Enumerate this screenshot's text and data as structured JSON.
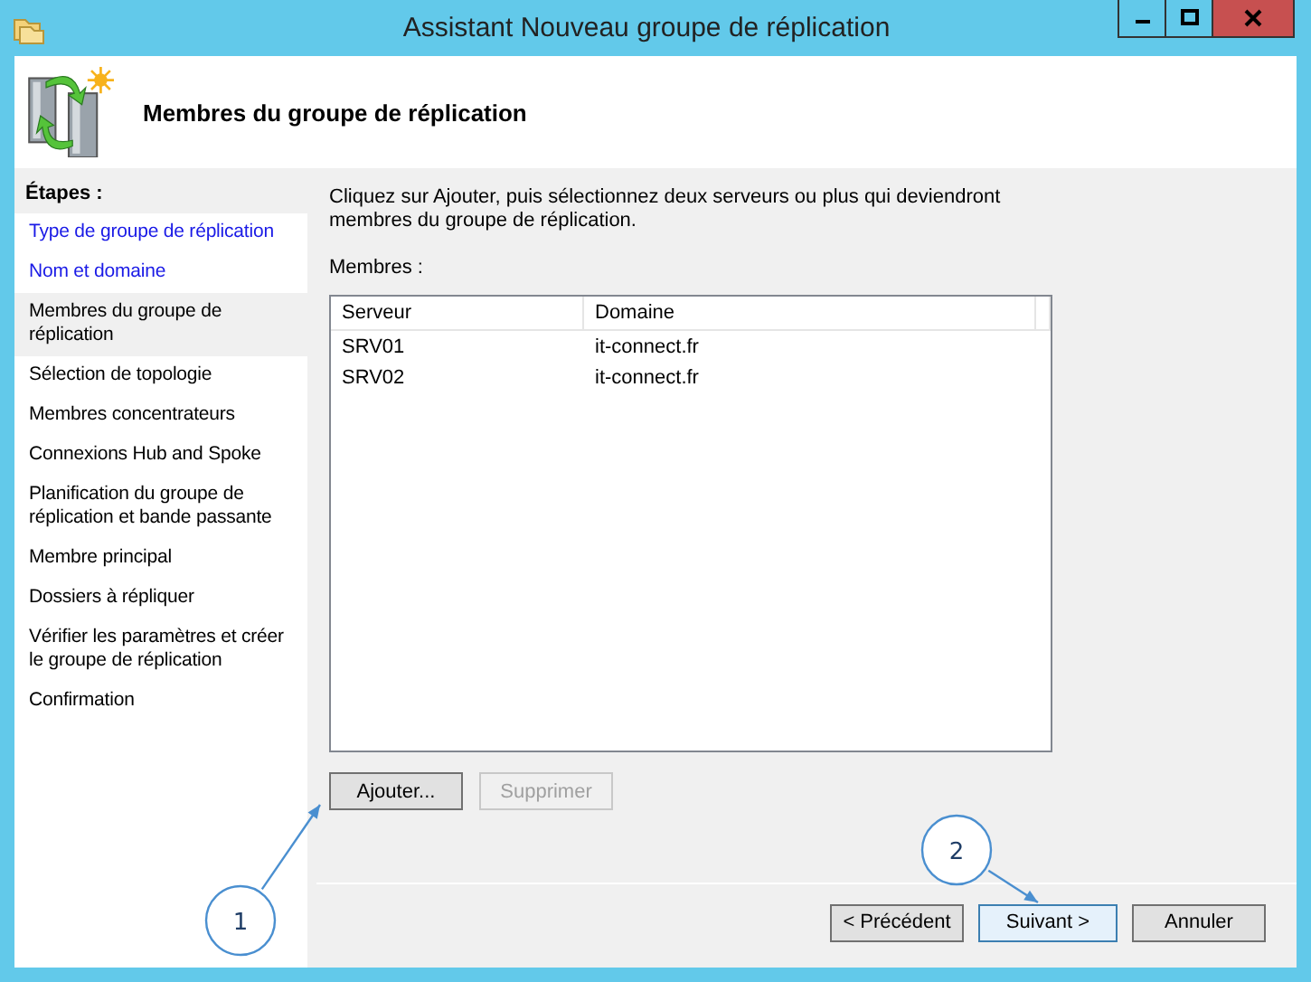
{
  "window": {
    "title": "Assistant Nouveau groupe de réplication"
  },
  "header": {
    "title": "Membres du groupe de réplication"
  },
  "sidebar": {
    "heading": "Étapes :",
    "items": [
      {
        "label": "Type de groupe de réplication",
        "completed": true,
        "selected": false
      },
      {
        "label": "Nom et domaine",
        "completed": true,
        "selected": false
      },
      {
        "label": "Membres du groupe de réplication",
        "completed": false,
        "selected": true
      },
      {
        "label": "Sélection de topologie",
        "completed": false,
        "selected": false
      },
      {
        "label": "Membres concentrateurs",
        "completed": false,
        "selected": false
      },
      {
        "label": "Connexions Hub and Spoke",
        "completed": false,
        "selected": false
      },
      {
        "label": "Planification du groupe de réplication et bande passante",
        "completed": false,
        "selected": false
      },
      {
        "label": "Membre principal",
        "completed": false,
        "selected": false
      },
      {
        "label": "Dossiers à répliquer",
        "completed": false,
        "selected": false
      },
      {
        "label": "Vérifier les paramètres et créer le groupe de réplication",
        "completed": false,
        "selected": false
      },
      {
        "label": "Confirmation",
        "completed": false,
        "selected": false
      }
    ]
  },
  "content": {
    "instructions": "Cliquez sur Ajouter, puis sélectionnez deux serveurs ou plus qui deviendront membres du groupe de réplication.",
    "list_label": "Membres :",
    "table": {
      "columns": [
        "Serveur",
        "Domaine"
      ],
      "rows": [
        [
          "SRV01",
          "it-connect.fr"
        ],
        [
          "SRV02",
          "it-connect.fr"
        ]
      ]
    },
    "buttons": [
      {
        "label": "Ajouter...",
        "disabled": false
      },
      {
        "label": "Supprimer",
        "disabled": true
      }
    ]
  },
  "footer": {
    "buttons": [
      {
        "label": "< Précédent",
        "disabled": false,
        "default": false
      },
      {
        "label": "Suivant >",
        "disabled": false,
        "default": true
      },
      {
        "label": "Annuler",
        "disabled": false,
        "default": false
      }
    ]
  },
  "annotations": [
    {
      "label": "1",
      "kind": "add"
    },
    {
      "label": "2",
      "kind": "next"
    }
  ]
}
